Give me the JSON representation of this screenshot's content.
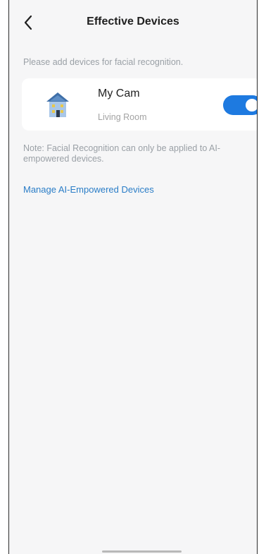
{
  "header": {
    "title": "Effective Devices",
    "back_icon": "chevron-left-icon"
  },
  "hint_text": "Please add devices for facial recognition.",
  "devices": [
    {
      "name": "My Cam",
      "room": "Living Room",
      "icon": "house-icon",
      "enabled": true
    }
  ],
  "note_text": "Note: Facial Recognition can only be applied to AI-empowered devices.",
  "manage_link_text": "Manage AI-Empowered Devices",
  "colors": {
    "accent": "#1e7ae0",
    "link": "#2a7dc7",
    "background": "#f6f6f7",
    "card": "#ffffff"
  }
}
